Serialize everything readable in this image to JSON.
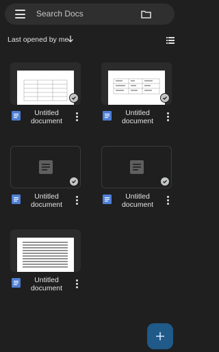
{
  "search": {
    "placeholder": "Search Docs"
  },
  "sort": {
    "label": "Last opened by me"
  },
  "documents": [
    {
      "title": "Untitled document"
    },
    {
      "title": "Untitled document"
    },
    {
      "title": "Untitled document"
    },
    {
      "title": "Untitled document"
    },
    {
      "title": "Untitled document"
    }
  ],
  "colors": {
    "accent": "#4f7fd6",
    "fab": "#1f5a88",
    "background": "#1f1f1f"
  }
}
